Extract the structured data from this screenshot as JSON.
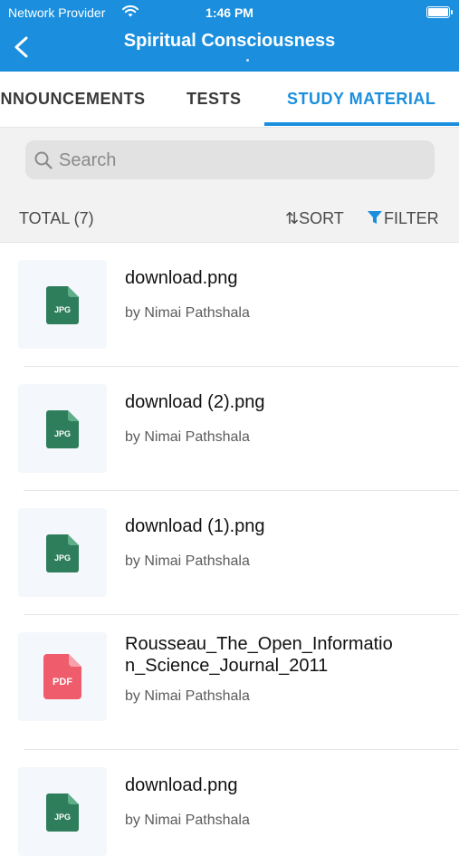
{
  "status_bar": {
    "provider": "Network Provider",
    "time": "1:46 PM"
  },
  "header": {
    "title": "Spiritual Consciousness"
  },
  "tabs": [
    {
      "label": "ANNOUNCEMENTS"
    },
    {
      "label": "TESTS"
    },
    {
      "label": "STUDY MATERIAL",
      "active": true
    }
  ],
  "search": {
    "placeholder": "Search"
  },
  "toolbar": {
    "total": "TOTAL (7)",
    "sort": "SORT",
    "filter": "FILTER"
  },
  "items": [
    {
      "name": "download.png",
      "author": "by Nimai Pathshala",
      "type": "JPG"
    },
    {
      "name": "download (2).png",
      "author": "by Nimai Pathshala",
      "type": "JPG"
    },
    {
      "name": "download (1).png",
      "author": "by Nimai Pathshala",
      "type": "JPG"
    },
    {
      "name_line1": "Rousseau_The_Open_Informatio",
      "name_line2": "n_Science_Journal_2011",
      "author": "by Nimai Pathshala",
      "type": "PDF"
    },
    {
      "name": "download.png",
      "author": "by Nimai Pathshala",
      "type": "JPG"
    }
  ],
  "colors": {
    "primary": "#1b8fde",
    "jpg_icon": "#2e7d5b",
    "pdf_icon": "#ef5d6c"
  }
}
